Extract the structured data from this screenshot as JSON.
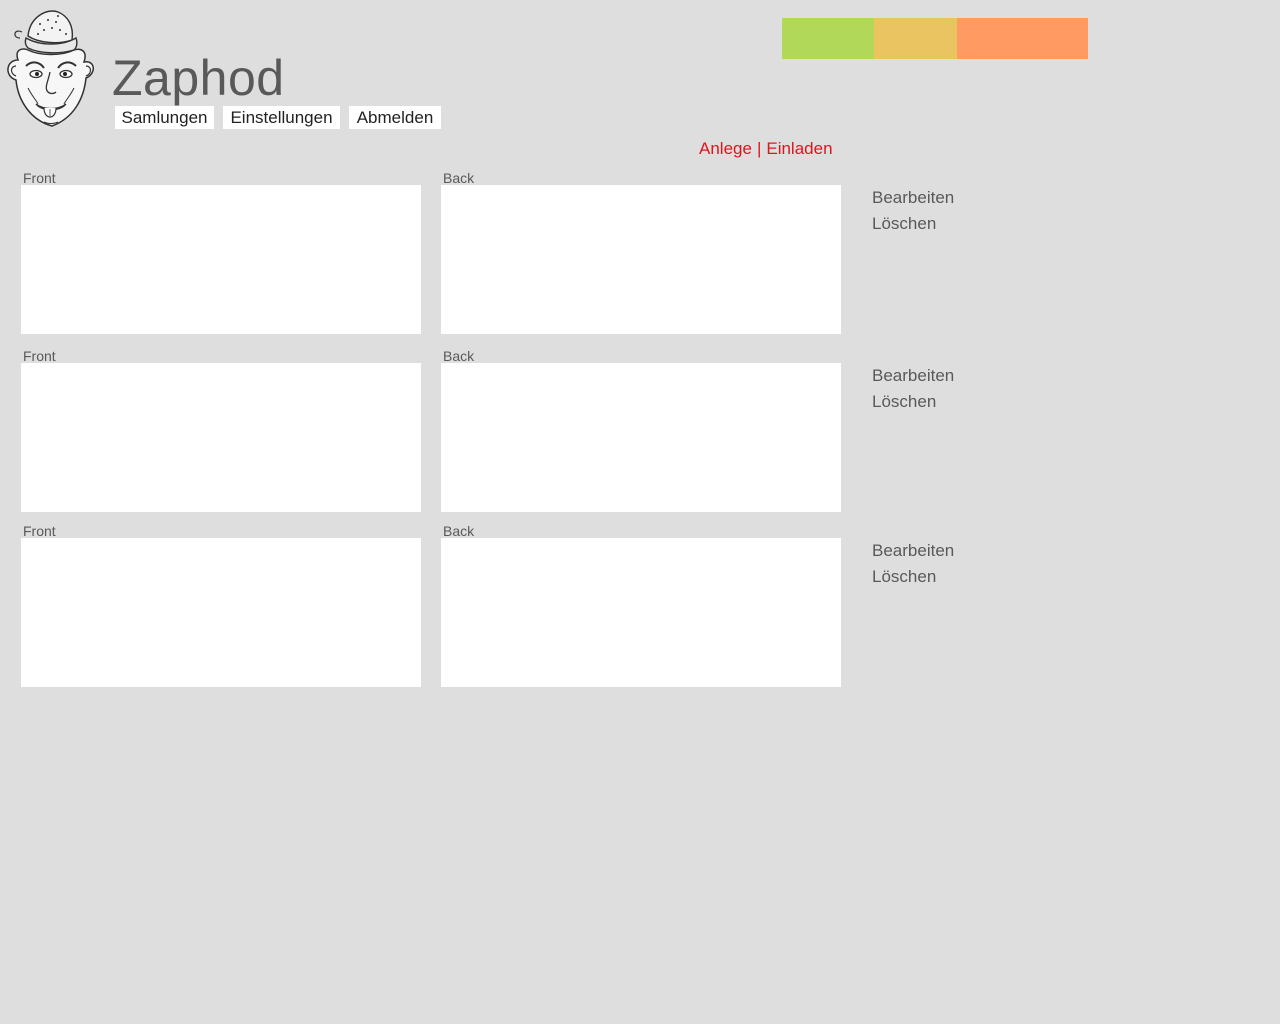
{
  "header": {
    "app_title": "Zaphod",
    "logo_icon": "cartoon-face-logo-icon"
  },
  "nav": {
    "items": [
      {
        "label": "Samlungen"
      },
      {
        "label": "Einstellungen"
      },
      {
        "label": "Abmelden"
      }
    ]
  },
  "status_bar": {
    "segments": [
      {
        "color": "#b1d858",
        "fraction": 0.3
      },
      {
        "color": "#eac461",
        "fraction": 0.27
      },
      {
        "color": "#ff9a62",
        "fraction": 0.43
      }
    ]
  },
  "top_actions": {
    "create_label": "Anlege",
    "separator": "|",
    "invite_label": "Einladen",
    "color": "#e0141e"
  },
  "cards": [
    {
      "front_label": "Front",
      "back_label": "Back",
      "edit_label": "Bearbeiten",
      "delete_label": "Löschen"
    },
    {
      "front_label": "Front",
      "back_label": "Back",
      "edit_label": "Bearbeiten",
      "delete_label": "Löschen"
    },
    {
      "front_label": "Front",
      "back_label": "Back",
      "edit_label": "Bearbeiten",
      "delete_label": "Löschen"
    }
  ]
}
